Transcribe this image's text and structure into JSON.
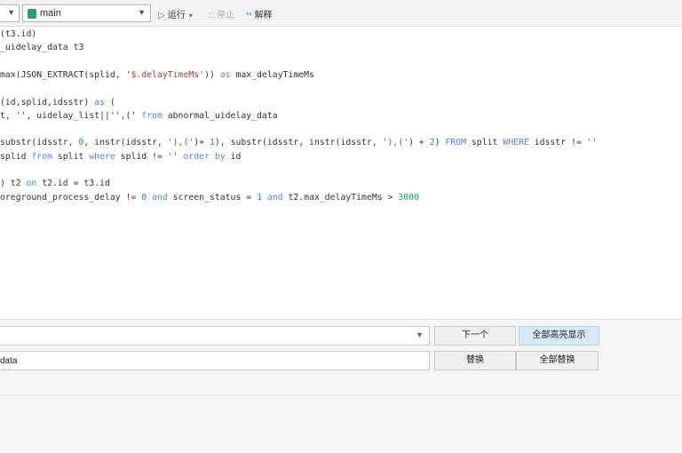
{
  "toolbar": {
    "database": "main",
    "run_label": "运行",
    "stop_label": "停止",
    "explain_label": "解释"
  },
  "editor": {
    "lines": [
      [
        {
          "t": "(t3.id)"
        }
      ],
      [
        {
          "t": "_uidelay_data t3"
        }
      ],
      [
        {
          "t": ""
        }
      ],
      [
        {
          "t": "max(JSON_EXTRACT(splid, "
        },
        {
          "t": "'$.delayTimeMs'",
          "c": "str"
        },
        {
          "t": ")) "
        },
        {
          "t": "as",
          "c": "kw"
        },
        {
          "t": " max_delayTimeMs"
        }
      ],
      [
        {
          "t": ""
        }
      ],
      [
        {
          "t": "(id,splid,idsstr) "
        },
        {
          "t": "as",
          "c": "kw"
        },
        {
          "t": " ("
        }
      ],
      [
        {
          "t": "t, '', uidelay_list||'',(' "
        },
        {
          "t": "from",
          "c": "kw"
        },
        {
          "t": " abnormal_uidelay_data"
        }
      ],
      [
        {
          "t": ""
        }
      ],
      [
        {
          "t": "substr(idsstr, "
        },
        {
          "t": "0",
          "c": "num"
        },
        {
          "t": ", instr(idsstr, "
        },
        {
          "t": "'),('",
          "c": "str"
        },
        {
          "t": ")+ "
        },
        {
          "t": "1",
          "c": "num"
        },
        {
          "t": "), substr(idsstr, instr(idsstr, "
        },
        {
          "t": "'),('",
          "c": "str"
        },
        {
          "t": ") + "
        },
        {
          "t": "2",
          "c": "num"
        },
        {
          "t": ") "
        },
        {
          "t": "FROM",
          "c": "kw"
        },
        {
          "t": " split "
        },
        {
          "t": "WHERE",
          "c": "kw"
        },
        {
          "t": " idsstr != "
        },
        {
          "t": "''",
          "c": "str"
        }
      ],
      [
        {
          "t": "splid "
        },
        {
          "t": "from",
          "c": "kw"
        },
        {
          "t": " split "
        },
        {
          "t": "where",
          "c": "kw"
        },
        {
          "t": " splid != "
        },
        {
          "t": "''",
          "c": "str"
        },
        {
          "t": " "
        },
        {
          "t": "order by",
          "c": "kw"
        },
        {
          "t": " id"
        }
      ],
      [
        {
          "t": ""
        }
      ],
      [
        {
          "t": ") t2 "
        },
        {
          "t": "on",
          "c": "kw"
        },
        {
          "t": " t2.id = t3.id"
        }
      ],
      [
        {
          "t": "oreground_process_delay != "
        },
        {
          "t": "0",
          "c": "num"
        },
        {
          "t": " "
        },
        {
          "t": "and",
          "c": "kw"
        },
        {
          "t": " screen_status = "
        },
        {
          "t": "1",
          "c": "num"
        },
        {
          "t": " "
        },
        {
          "t": "and",
          "c": "kw"
        },
        {
          "t": " t2.max_delayTimeMs > "
        },
        {
          "t": "3000",
          "c": "num"
        }
      ]
    ]
  },
  "find": {
    "search_value": "",
    "replace_value": "data",
    "next_label": "下一个",
    "highlight_all_label": "全部高亮显示",
    "replace_label": "替换",
    "replace_all_label": "全部替换"
  }
}
